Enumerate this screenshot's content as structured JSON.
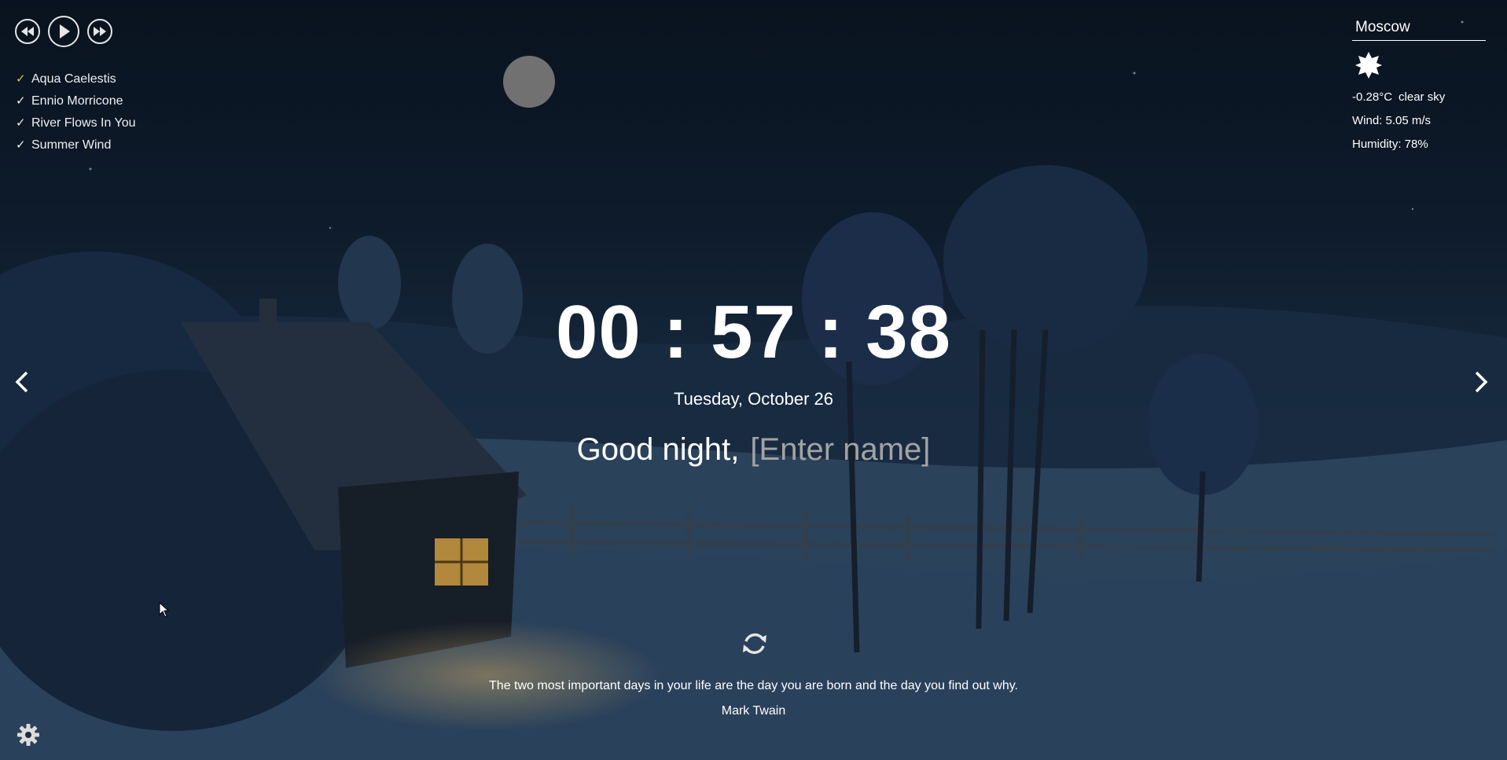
{
  "player": {
    "prev_icon": "rewind-icon",
    "play_icon": "play-icon",
    "next_icon": "fast-forward-icon",
    "playlist": [
      {
        "title": "Aqua Caelestis",
        "active": true
      },
      {
        "title": "Ennio Morricone",
        "active": false
      },
      {
        "title": "River Flows In You",
        "active": false
      },
      {
        "title": "Summer Wind",
        "active": false
      }
    ],
    "check_glyph": "✓",
    "active_color": "#d9c34a"
  },
  "weather": {
    "city": "Moscow",
    "icon": "clear-sky-icon",
    "temperature": "-0.28°C",
    "description": "clear sky",
    "wind": "Wind: 5.05 m/s",
    "humidity": "Humidity: 78%"
  },
  "clock": {
    "time": "00 : 57 : 38",
    "date": "Tuesday, October 26"
  },
  "greeting": {
    "text": "Good night,",
    "name_placeholder": "[Enter name]"
  },
  "quote": {
    "text": "The two most important days in your life are the day you are born and the day you find out why.",
    "author": "Mark Twain"
  },
  "icons": {
    "prev_slide": "chevron-left-icon",
    "next_slide": "chevron-right-icon",
    "refresh": "refresh-icon",
    "settings": "gear-icon"
  }
}
